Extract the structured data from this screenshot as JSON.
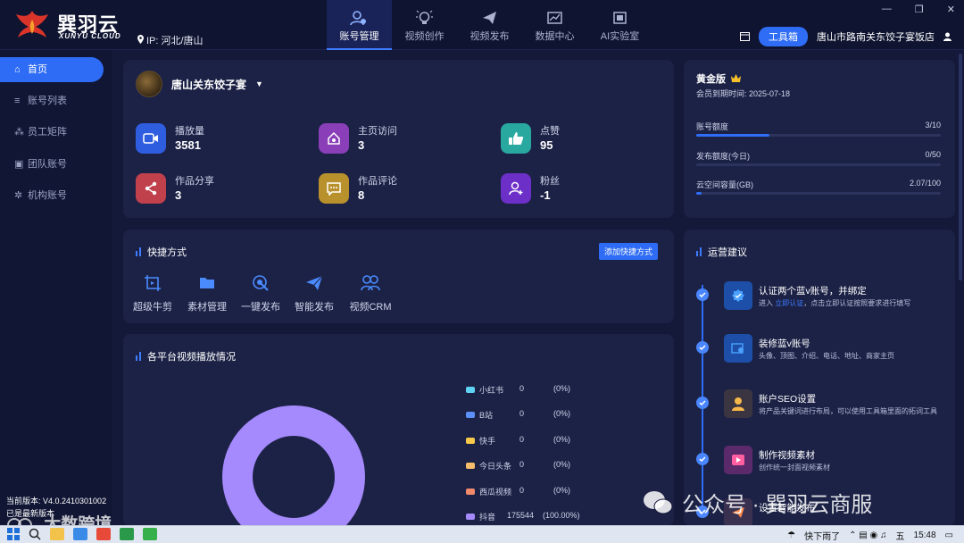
{
  "app": {
    "brand_cn": "巽羽云",
    "brand_en": "XUNYU CLOUD",
    "ip_label": "IP: 河北/唐山"
  },
  "nav": {
    "items": [
      {
        "label": "账号管理",
        "icon": "user-gear-icon",
        "active": true
      },
      {
        "label": "视频创作",
        "icon": "bulb-icon",
        "active": false
      },
      {
        "label": "视频发布",
        "icon": "paper-plane-icon",
        "active": false
      },
      {
        "label": "数据中心",
        "icon": "chart-icon",
        "active": false
      },
      {
        "label": "AI实验室",
        "icon": "chip-icon",
        "active": false
      }
    ]
  },
  "header": {
    "toolbox_label": "工具箱",
    "store_name": "唐山市路南关东饺子宴饭店"
  },
  "sidebar": {
    "items": [
      {
        "label": "首页",
        "icon": "home-icon",
        "active": true
      },
      {
        "label": "账号列表",
        "icon": "list-icon",
        "active": false
      },
      {
        "label": "员工矩阵",
        "icon": "org-icon",
        "active": false
      },
      {
        "label": "团队账号",
        "icon": "team-icon",
        "active": false
      },
      {
        "label": "机构账号",
        "icon": "gear-icon",
        "active": false
      }
    ],
    "version_label": "当前版本: V4.0.2410301002",
    "version_status": "已是最新版本"
  },
  "account": {
    "name": "唐山关东饺子宴",
    "stats": [
      {
        "label": "播放量",
        "value": "3581",
        "icon": "video-icon",
        "color": "#2f5de0"
      },
      {
        "label": "主页访问",
        "value": "3",
        "icon": "home-icon",
        "color": "#8a3fb8"
      },
      {
        "label": "点赞",
        "value": "95",
        "icon": "thumbs-up-icon",
        "color": "#29a8a0"
      },
      {
        "label": "作品分享",
        "value": "3",
        "icon": "share-icon",
        "color": "#c0404c"
      },
      {
        "label": "作品评论",
        "value": "8",
        "icon": "comment-icon",
        "color": "#b8902c"
      },
      {
        "label": "粉丝",
        "value": "-1",
        "icon": "follower-icon",
        "color": "#6c2fc8"
      }
    ]
  },
  "shortcuts": {
    "title": "快捷方式",
    "add_label": "添加快捷方式",
    "items": [
      {
        "label": "超级牛剪",
        "icon": "crop-video-icon"
      },
      {
        "label": "素材管理",
        "icon": "folder-icon"
      },
      {
        "label": "一键发布",
        "icon": "target-cursor-icon"
      },
      {
        "label": "智能发布",
        "icon": "paper-plane-icon"
      },
      {
        "label": "视频CRM",
        "icon": "users-icon"
      }
    ]
  },
  "platform": {
    "title": "各平台视频播放情况"
  },
  "chart_data": {
    "type": "pie",
    "title": "各平台视频播放情况",
    "categories": [
      "小红书",
      "B站",
      "快手",
      "今日头条",
      "西瓜视频",
      "抖音"
    ],
    "values": [
      0,
      0,
      0,
      0,
      0,
      175544
    ],
    "percent_labels": [
      "(0%)",
      "(0%)",
      "(0%)",
      "(0%)",
      "(0%)",
      "(100.00%)"
    ],
    "colors": [
      "#5fd3f3",
      "#5b8ff9",
      "#f6c94a",
      "#f6bd6a",
      "#f08a6a",
      "#a58afd"
    ],
    "legend": "right",
    "donut": true
  },
  "vip": {
    "title": "黄金版",
    "expiry": "会员到期时间: 2025-07-18",
    "quotas": [
      {
        "label": "账号额度",
        "value": "3/10",
        "fraction": 0.3
      },
      {
        "label": "发布额度(今日)",
        "value": "0/50",
        "fraction": 0
      },
      {
        "label": "云空间容量(GB)",
        "value": "2.07/100",
        "fraction": 0.0207
      }
    ]
  },
  "advice": {
    "title": "运营建议",
    "steps": [
      {
        "title": "认证两个蓝v账号，并绑定",
        "desc_prefix": "进入 ",
        "desc_link": "立即认证",
        "desc_suffix": "，点击立即认证按照要求进行填写",
        "icon": "verify-icon",
        "color": "#1d4fa8"
      },
      {
        "title": "装修蓝v账号",
        "desc_prefix": "头像、顶图、介绍、电话、地址、商家主页",
        "desc_link": "",
        "desc_suffix": "",
        "icon": "shop-icon",
        "color": "#1d4fa8"
      },
      {
        "title": "账户SEO设置",
        "desc_prefix": "将产品关键词进行布局，可以使用工具箱里面的拓词工具",
        "desc_link": "",
        "desc_suffix": "",
        "icon": "person-icon",
        "color": "#3a3540"
      },
      {
        "title": "制作视频素材",
        "desc_prefix": "创作统一封面视频素材",
        "desc_link": "",
        "desc_suffix": "",
        "icon": "video-play-icon",
        "color": "#5a2a6a"
      },
      {
        "title": "设置智能发布",
        "desc_prefix": "",
        "desc_link": "",
        "desc_suffix": "",
        "icon": "send-icon",
        "color": "#3a3050"
      }
    ]
  },
  "watermark": {
    "left_text": "大数跨境",
    "right_text": "公众号 · 巽羽云商服"
  },
  "taskbar": {
    "weather": "快下雨了",
    "ime": "五",
    "time": "15:48"
  }
}
